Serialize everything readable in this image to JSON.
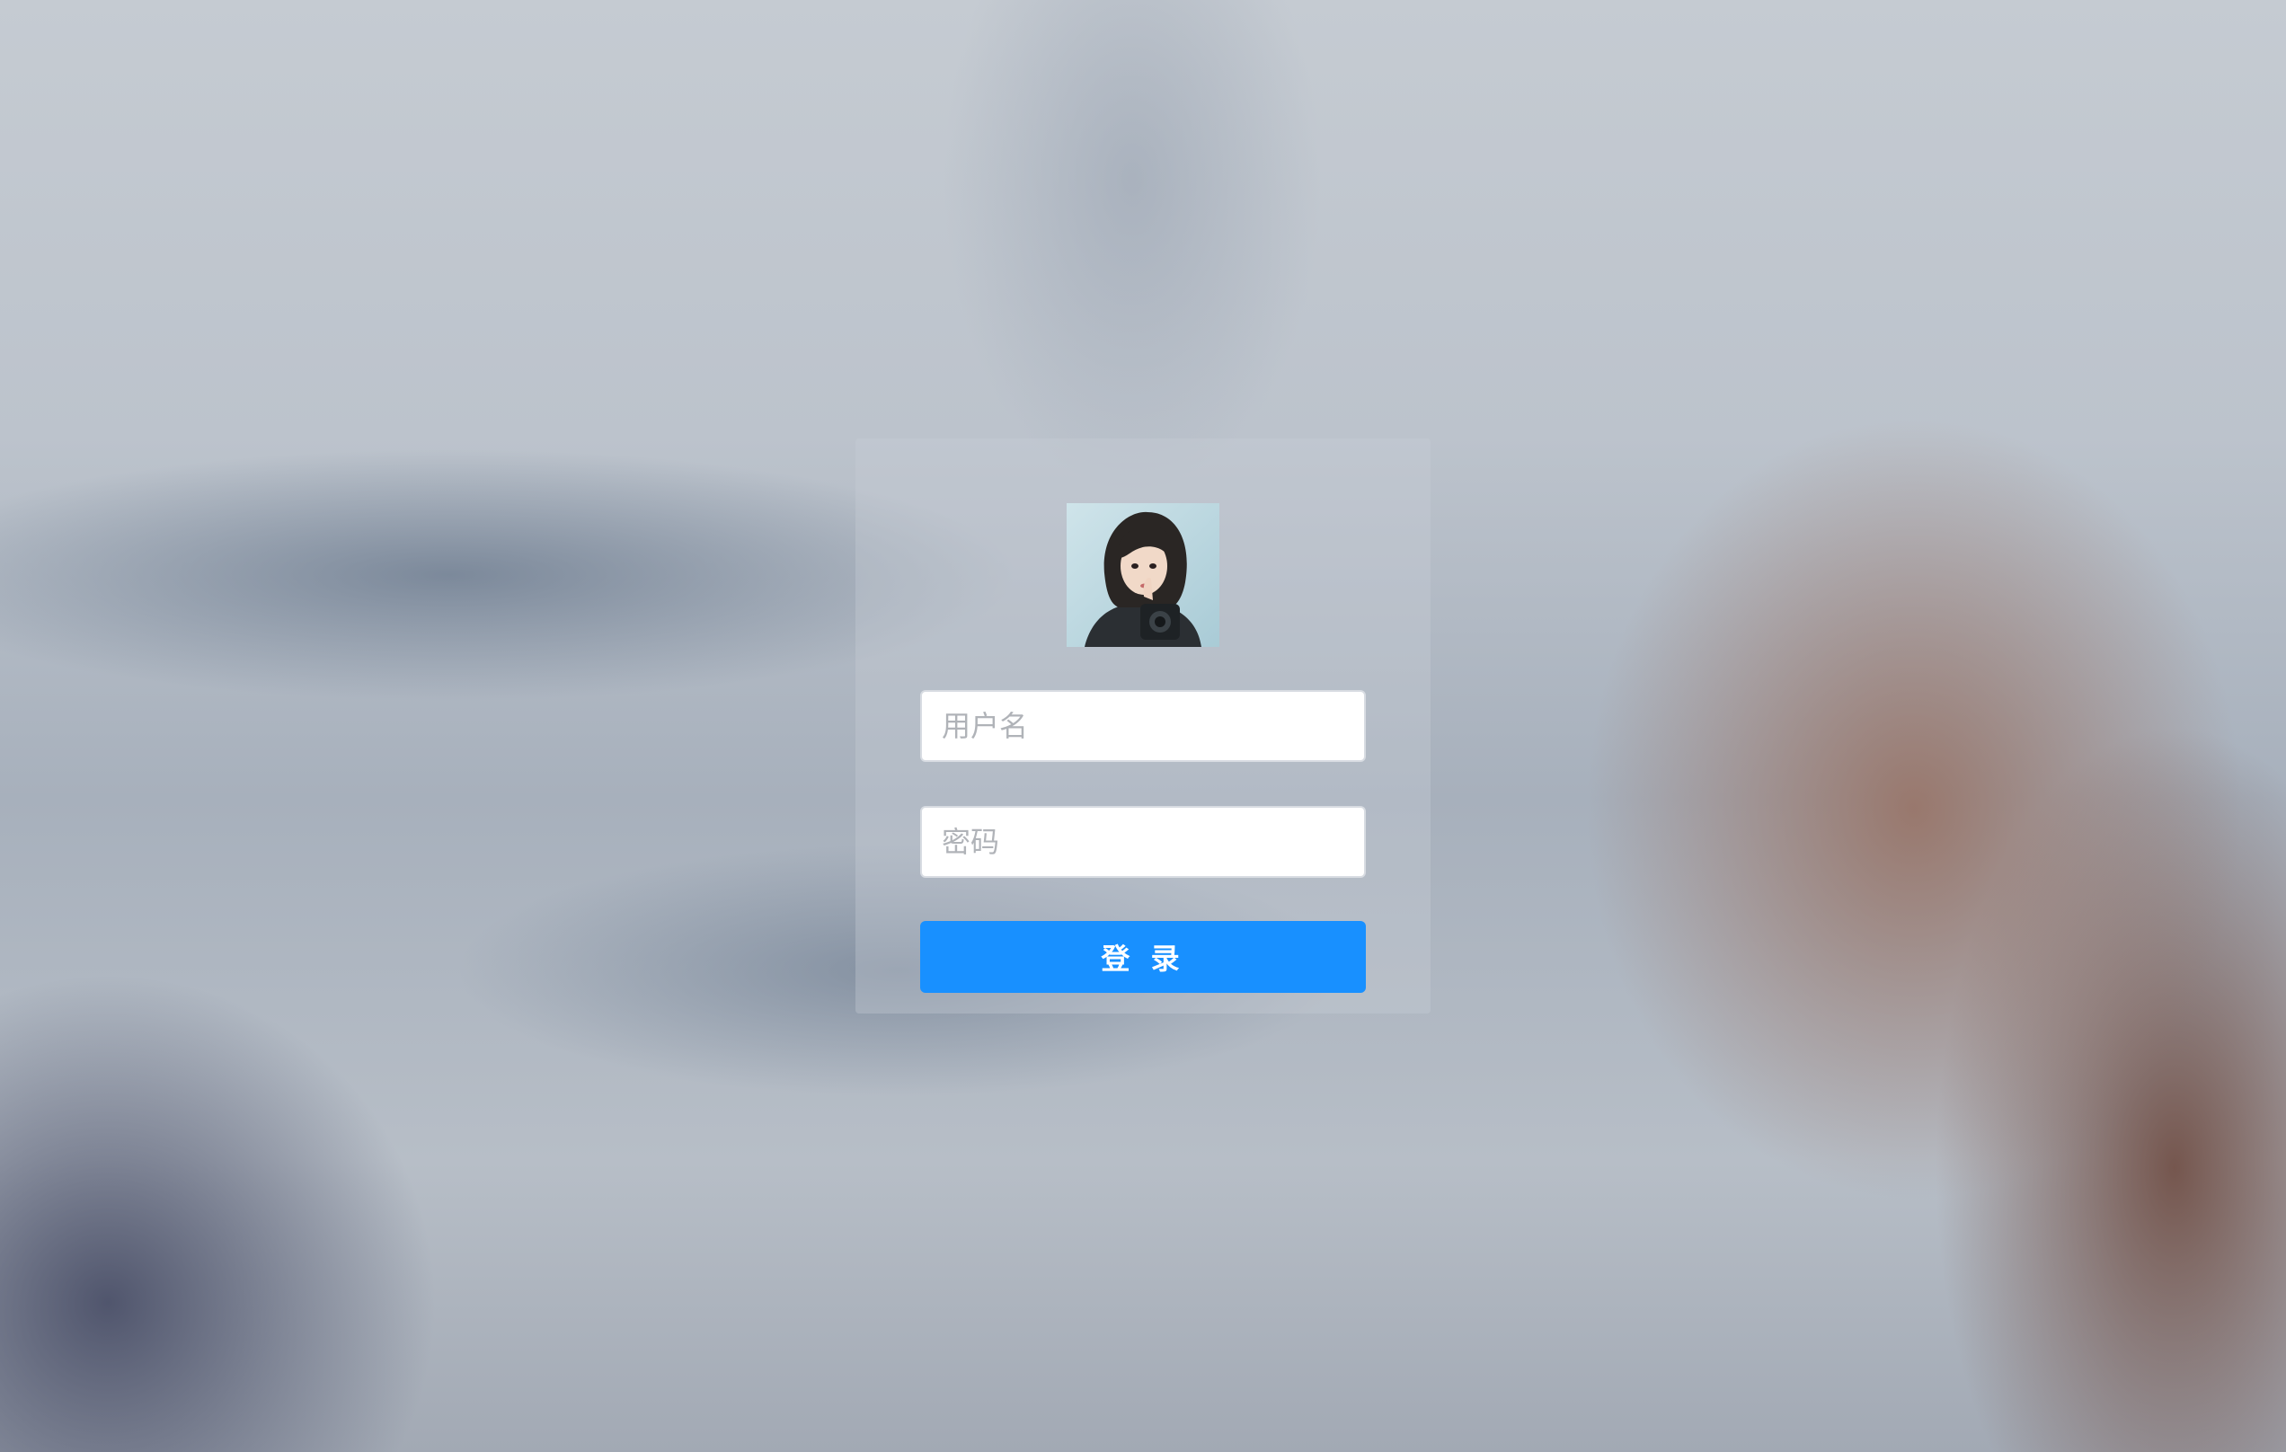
{
  "login": {
    "avatar_icon": "avatar-photo",
    "username_placeholder": "用户名",
    "username_value": "",
    "password_placeholder": "密码",
    "password_value": "",
    "submit_label": "登 录"
  },
  "colors": {
    "primary_button": "#1890ff",
    "button_text": "#ffffff",
    "input_background": "#ffffff",
    "placeholder_text": "#b0b3b8"
  }
}
